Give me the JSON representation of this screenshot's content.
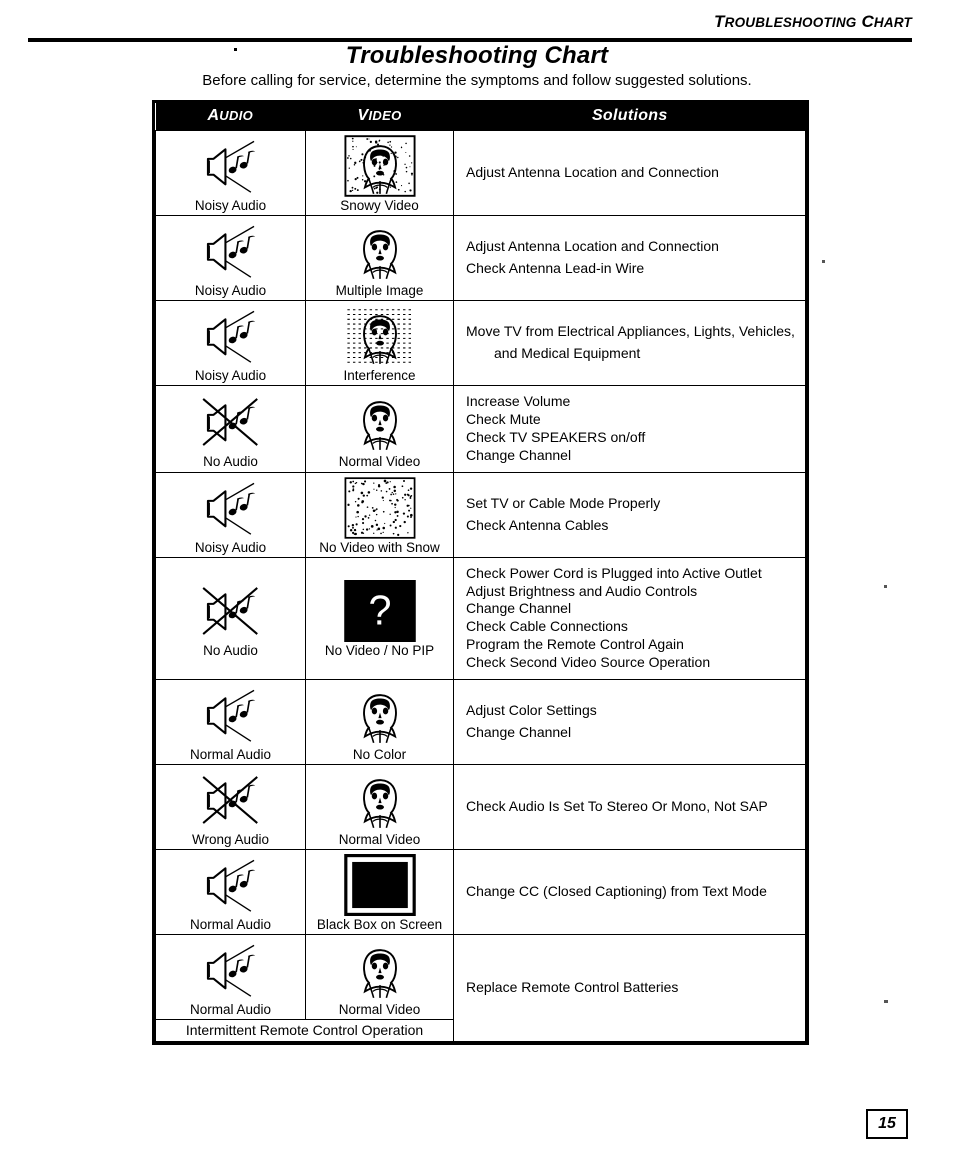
{
  "running_head": "TROUBLESHOOTING CHART",
  "title": "Troubleshooting Chart",
  "subtitle": "Before calling for service, determine the symptoms and follow suggested solutions.",
  "page_number": "15",
  "table": {
    "headers": {
      "audio": "AUDIO",
      "video": "VIDEO",
      "solutions": "Solutions"
    },
    "rows": [
      {
        "audio_label": "Noisy Audio",
        "audio_icon": "noisy-speaker-icon",
        "video_label": "Snowy Video",
        "video_icon": "snowy-face-icon",
        "solutions": [
          "Adjust Antenna Location and Connection"
        ]
      },
      {
        "audio_label": "Noisy Audio",
        "audio_icon": "noisy-speaker-icon",
        "video_label": "Multiple Image",
        "video_icon": "multiple-image-face-icon",
        "solutions": [
          "Adjust Antenna Location and Connection",
          "Check Antenna Lead-in Wire"
        ]
      },
      {
        "audio_label": "Noisy Audio",
        "audio_icon": "noisy-speaker-icon",
        "video_label": "Interference",
        "video_icon": "interference-face-icon",
        "solutions": [
          "Move TV from Electrical Appliances, Lights, Vehicles,",
          "and Medical Equipment"
        ]
      },
      {
        "audio_label": "No Audio",
        "audio_icon": "muted-speaker-icon",
        "video_label": "Normal Video",
        "video_icon": "normal-face-icon",
        "solutions": [
          "Increase Volume",
          "Check Mute",
          "Check TV SPEAKERS on/off",
          "Change Channel"
        ]
      },
      {
        "audio_label": "Noisy Audio",
        "audio_icon": "noisy-speaker-icon",
        "video_label": "No Video with Snow",
        "video_icon": "snow-only-icon",
        "solutions": [
          "Set TV or Cable Mode Properly",
          "Check Antenna Cables"
        ]
      },
      {
        "audio_label": "No Audio",
        "audio_icon": "muted-speaker-icon",
        "video_label": "No Video / No PIP",
        "video_icon": "question-mark-screen-icon",
        "solutions": [
          "Check Power Cord is Plugged into Active Outlet",
          "Adjust Brightness and Audio Controls",
          "Change Channel",
          "Check Cable Connections",
          "Program the Remote Control Again",
          "Check Second Video Source Operation"
        ]
      },
      {
        "audio_label": "Normal Audio",
        "audio_icon": "noisy-speaker-icon",
        "video_label": "No Color",
        "video_icon": "normal-face-icon",
        "solutions": [
          "Adjust Color Settings",
          "Change Channel"
        ]
      },
      {
        "audio_label": "Wrong Audio",
        "audio_icon": "muted-speaker-icon",
        "video_label": "Normal Video",
        "video_icon": "normal-face-icon",
        "solutions": [
          "Check Audio Is Set To Stereo Or Mono, Not SAP"
        ]
      },
      {
        "audio_label": "Normal Audio",
        "audio_icon": "noisy-speaker-icon",
        "video_label": "Black Box on Screen",
        "video_icon": "black-box-icon",
        "solutions": [
          "Change CC (Closed Captioning) from Text Mode"
        ]
      },
      {
        "audio_label": "Normal Audio",
        "audio_icon": "noisy-speaker-icon",
        "video_label": "Normal Video",
        "video_icon": "normal-face-icon",
        "solutions": [
          "Replace Remote Control Batteries"
        ],
        "span_label": "Intermittent Remote Control Operation"
      }
    ]
  }
}
